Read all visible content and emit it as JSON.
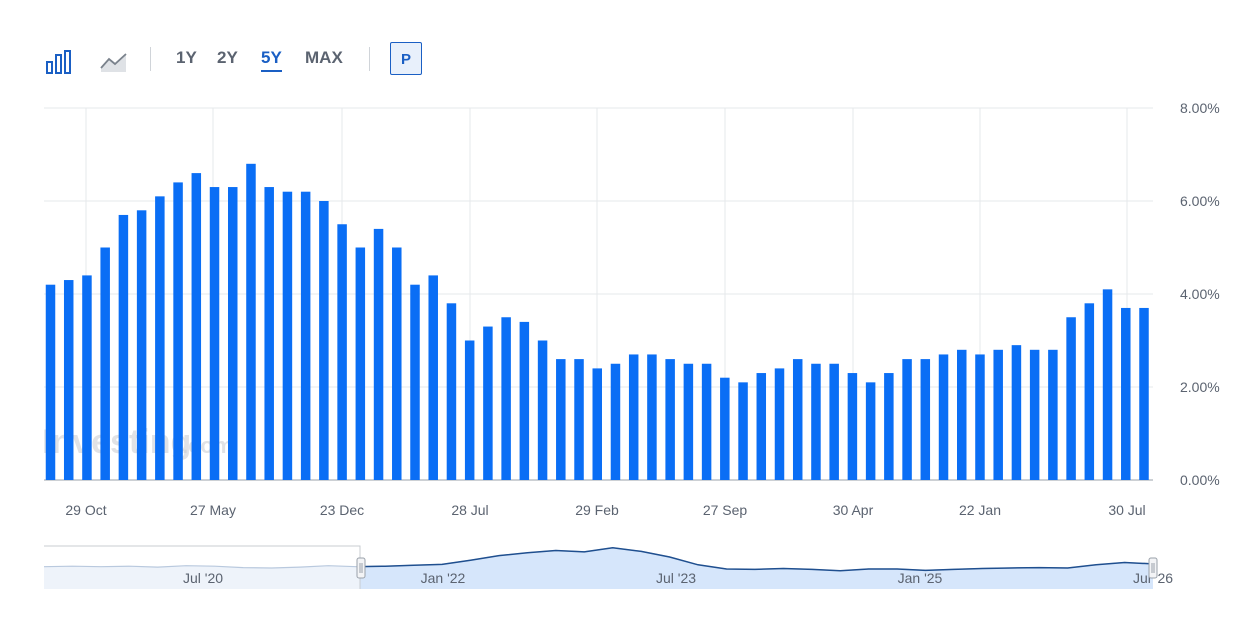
{
  "toolbar": {
    "bar_icon": "bar-chart-icon",
    "line_icon": "area-chart-icon",
    "ranges": [
      "1Y",
      "2Y",
      "5Y",
      "MAX"
    ],
    "active_range": "5Y",
    "p_button": "P"
  },
  "watermark": {
    "brand": "Investing",
    "suffix": ".com"
  },
  "colors": {
    "bar": "#0a6ef5",
    "navigator_line": "#1f4f8f",
    "navigator_fill": "#d6e6fb",
    "grid": "#e6e8eb"
  },
  "chart_data": {
    "type": "bar",
    "title": "",
    "xlabel": "",
    "ylabel": "",
    "ylim": [
      0,
      8
    ],
    "y_ticks": [
      "8.00%",
      "6.00%",
      "4.00%",
      "2.00%",
      "0.00%"
    ],
    "x_ticks": [
      "29 Oct",
      "27 May",
      "23 Dec",
      "28 Jul",
      "29 Feb",
      "27 Sep",
      "30 Apr",
      "22 Jan",
      "30 Jul"
    ],
    "values": [
      4.2,
      4.3,
      4.4,
      5.0,
      5.7,
      5.8,
      6.1,
      6.4,
      6.6,
      6.3,
      6.3,
      6.8,
      6.3,
      6.2,
      6.2,
      6.0,
      5.5,
      5.0,
      5.4,
      5.0,
      4.2,
      4.4,
      3.8,
      3.0,
      3.3,
      3.5,
      3.4,
      3.0,
      2.6,
      2.6,
      2.4,
      2.5,
      2.7,
      2.7,
      2.6,
      2.5,
      2.5,
      2.2,
      2.1,
      2.3,
      2.4,
      2.6,
      2.5,
      2.5,
      2.3,
      2.1,
      2.3,
      2.6,
      2.6,
      2.7,
      2.8,
      2.7,
      2.8,
      2.9,
      2.8,
      2.8,
      3.5,
      3.8,
      4.1,
      3.7,
      3.7
    ],
    "grid": true,
    "navigator": {
      "labels": [
        "Jul '20",
        "Jan '22",
        "Jul '23",
        "Jan '25",
        "Jul '26"
      ],
      "values": [
        3.1,
        3.2,
        3.1,
        3.2,
        3.0,
        3.3,
        3.2,
        2.9,
        2.8,
        3.0,
        3.3,
        3.1,
        3.2,
        3.4,
        3.6,
        4.5,
        5.5,
        6.1,
        6.6,
        6.3,
        7.2,
        6.4,
        5.2,
        3.5,
        2.6,
        2.5,
        2.7,
        2.5,
        2.2,
        2.6,
        2.6,
        2.3,
        2.5,
        2.7,
        2.8,
        2.9,
        2.8,
        3.5,
        4.0,
        3.7
      ]
    }
  }
}
